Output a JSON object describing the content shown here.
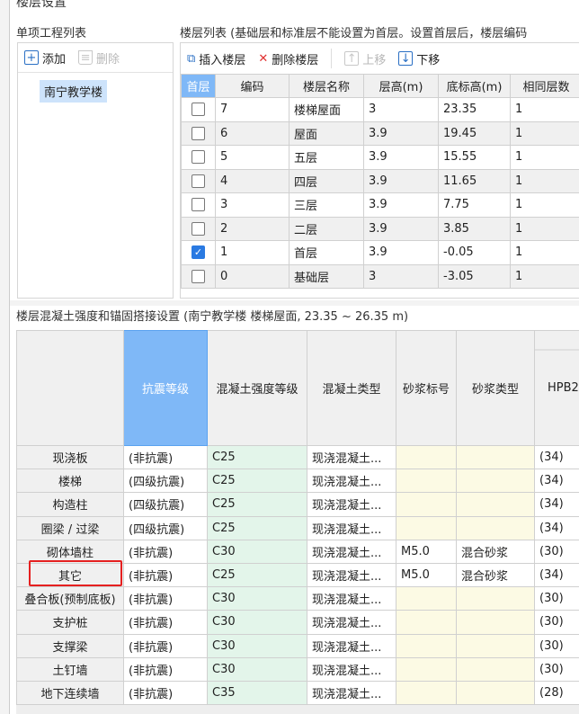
{
  "window": {
    "title": "楼层设置"
  },
  "left_panel": {
    "label": "单项工程列表",
    "add": "添加",
    "delete": "删除",
    "items": [
      "南宁教学楼"
    ]
  },
  "floor_panel": {
    "label": "楼层列表 (基础层和标准层不能设置为首层。设置首层后，楼层编码",
    "insert": "插入楼层",
    "delete": "删除楼层",
    "up": "上移",
    "down": "下移",
    "columns": [
      "首层",
      "编码",
      "楼层名称",
      "层高(m)",
      "底标高(m)",
      "相同层数"
    ],
    "rows": [
      {
        "first": false,
        "code": "7",
        "name": "楼梯屋面",
        "height": "3",
        "elev": "23.35",
        "same": "1"
      },
      {
        "first": false,
        "code": "6",
        "name": "屋面",
        "height": "3.9",
        "elev": "19.45",
        "same": "1"
      },
      {
        "first": false,
        "code": "5",
        "name": "五层",
        "height": "3.9",
        "elev": "15.55",
        "same": "1"
      },
      {
        "first": false,
        "code": "4",
        "name": "四层",
        "height": "3.9",
        "elev": "11.65",
        "same": "1"
      },
      {
        "first": false,
        "code": "3",
        "name": "三层",
        "height": "3.9",
        "elev": "7.75",
        "same": "1"
      },
      {
        "first": false,
        "code": "2",
        "name": "二层",
        "height": "3.9",
        "elev": "3.85",
        "same": "1"
      },
      {
        "first": true,
        "code": "1",
        "name": "首层",
        "height": "3.9",
        "elev": "-0.05",
        "same": "1"
      },
      {
        "first": false,
        "code": "0",
        "name": "基础层",
        "height": "3",
        "elev": "-3.05",
        "same": "1"
      }
    ]
  },
  "concrete_panel": {
    "label": "楼层混凝土强度和锚固搭接设置 (南宁教学楼  楼梯屋面, 23.35 ~ 26.35 m)",
    "columns": [
      "",
      "抗震等级",
      "混凝土强度等级",
      "混凝土类型",
      "砂浆标号",
      "砂浆类型",
      "HPB2..."
    ],
    "rows": [
      [
        "现浇板",
        "(非抗震)",
        "C25",
        "现浇混凝土...",
        "",
        "",
        "(34)"
      ],
      [
        "楼梯",
        "(四级抗震)",
        "C25",
        "现浇混凝土...",
        "",
        "",
        "(34)"
      ],
      [
        "构造柱",
        "(四级抗震)",
        "C25",
        "现浇混凝土...",
        "",
        "",
        "(34)"
      ],
      [
        "圈梁 / 过梁",
        "(四级抗震)",
        "C25",
        "现浇混凝土...",
        "",
        "",
        "(34)"
      ],
      [
        "砌体墙柱",
        "(非抗震)",
        "C30",
        "现浇混凝土...",
        "M5.0",
        "混合砂浆",
        "(30)"
      ],
      [
        "其它",
        "(非抗震)",
        "C25",
        "现浇混凝土...",
        "M5.0",
        "混合砂浆",
        "(34)"
      ],
      [
        "叠合板(预制底板)",
        "(非抗震)",
        "C30",
        "现浇混凝土...",
        "",
        "",
        "(30)"
      ],
      [
        "支护桩",
        "(非抗震)",
        "C30",
        "现浇混凝土...",
        "",
        "",
        "(30)"
      ],
      [
        "支撑梁",
        "(非抗震)",
        "C30",
        "现浇混凝土...",
        "",
        "",
        "(30)"
      ],
      [
        "土钉墙",
        "(非抗震)",
        "C30",
        "现浇混凝土...",
        "",
        "",
        "(30)"
      ],
      [
        "地下连续墙",
        "(非抗震)",
        "C35",
        "现浇混凝土...",
        "",
        "",
        "(28)"
      ]
    ],
    "highlighted_row": "其它"
  },
  "colors": {
    "accent": "#2a7ae2",
    "header_selected": "#7fb8f7",
    "highlight": "#e52020"
  }
}
